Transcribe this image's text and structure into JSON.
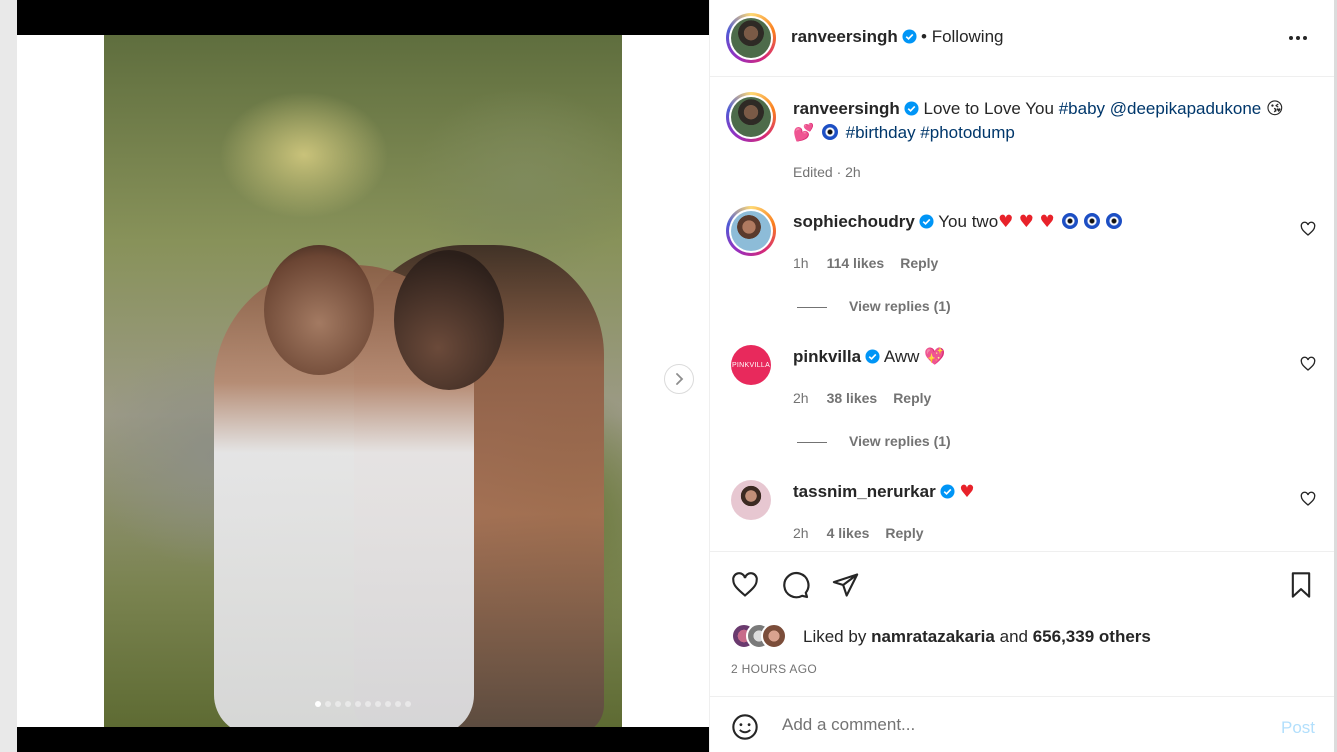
{
  "post": {
    "username": "ranveersingh",
    "separator": "•",
    "follow_status": "Following",
    "caption": {
      "username": "ranveersingh",
      "text_1": "Love to Love You",
      "hashtag_1": "#baby",
      "mention": "@deepikapadukone",
      "emoji_1": "😘",
      "emoji_2": "💕",
      "hashtags_2": "#birthday #photodump",
      "meta": "Edited · 2h"
    },
    "carousel": {
      "total": 10,
      "active": 1
    }
  },
  "comments": [
    {
      "username": "sophiechoudry",
      "text": "You two",
      "time": "1h",
      "likes": "114 likes",
      "reply": "Reply",
      "view_replies": "View replies (1)"
    },
    {
      "username": "pinkvilla",
      "avatar_text": "PINKVILLA",
      "text": "Aww",
      "emoji": "💖",
      "time": "2h",
      "likes": "38 likes",
      "reply": "Reply",
      "view_replies": "View replies (1)"
    },
    {
      "username": "tassnim_nerurkar",
      "text": "",
      "time": "2h",
      "likes": "4 likes",
      "reply": "Reply"
    }
  ],
  "likes": {
    "prefix": "Liked by",
    "user": "namratazakaria",
    "middle": "and",
    "count": "656,339 others"
  },
  "time_ago": "2 HOURS AGO",
  "add_comment": {
    "placeholder": "Add a comment...",
    "post_label": "Post"
  },
  "colors": {
    "verified": "#0095f6",
    "link": "#00376b",
    "heart": "#e8222a",
    "post_disabled": "#b2dffc"
  },
  "icons": [
    "more-icon",
    "verified-icon",
    "heart-icon",
    "comment-icon",
    "share-icon",
    "bookmark-icon",
    "emoji-icon",
    "chevron-right-icon"
  ]
}
